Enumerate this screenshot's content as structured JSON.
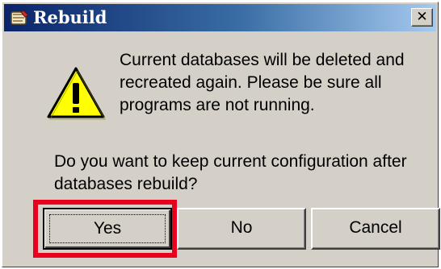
{
  "dialog": {
    "title": "Rebuild",
    "close_glyph": "✕",
    "message_lines": [
      "Current databases will be deleted and",
      "recreated again. Please be sure all",
      "programs are not running."
    ],
    "question_lines": [
      "Do you want to keep current configuration after",
      "databases rebuild?"
    ],
    "buttons": {
      "yes": "Yes",
      "no": "No",
      "cancel": "Cancel"
    }
  },
  "icons": {
    "app": "app-icon",
    "warning": "warning-icon",
    "close": "close-icon"
  },
  "colors": {
    "title_start": "#0a246a",
    "title_end": "#a6caf0",
    "highlight": "#e8001c",
    "warning": "#ffff00",
    "face": "#d4d0c8"
  }
}
